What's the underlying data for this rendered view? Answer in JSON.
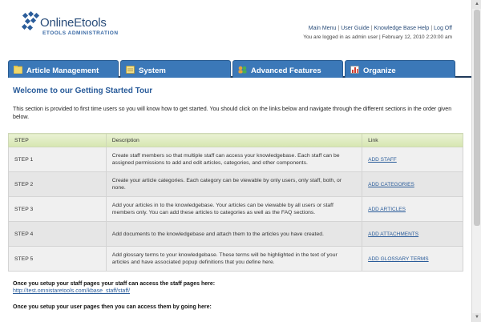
{
  "logo": {
    "name": "OnlineEtools",
    "subtitle": "ETOOLS ADMINISTRATION"
  },
  "header": {
    "links": [
      "Main Menu",
      "User Guide",
      "Knowledge Base Help",
      "Log Off"
    ],
    "login_status": "You are logged in as admin user | February 12, 2010 2:20:00 am"
  },
  "tabs": [
    {
      "label": "Article Management",
      "icon": "folder-icon",
      "color": "#f0d76a"
    },
    {
      "label": "System",
      "icon": "notepad-icon",
      "color": "#f4e08a"
    },
    {
      "label": "Advanced Features",
      "icon": "users-icon",
      "color": "#e8a23a"
    },
    {
      "label": "Organize",
      "icon": "chart-icon",
      "color": "#d23a2a"
    }
  ],
  "main": {
    "title": "Welcome to our Getting Started Tour",
    "intro": "This section is provided to first time users so you will know how to get started. You should click on the links below and navigate through the different sections in the order given below.",
    "table": {
      "headers": [
        "STEP",
        "Description",
        "Link"
      ],
      "rows": [
        {
          "step": "STEP 1",
          "desc": "Create staff members so that multiple staff can access your knowledgebase. Each staff can be assigned permissions to add and edit articles, categories, and other components.",
          "link": "ADD STAFF"
        },
        {
          "step": "STEP 2",
          "desc": "Create your article categories. Each category can be viewable by only users, only staff, both, or none.",
          "link": "ADD CATEGORIES"
        },
        {
          "step": "STEP 3",
          "desc": "Add your articles in to the knowledgebase. Your articles can be viewable by all users or staff members only. You can add these articles to categories as well as the FAQ sections.",
          "link": "ADD ARTICLES"
        },
        {
          "step": "STEP 4",
          "desc": "Add documents to the knowledgebase and attach them to the articles you have created.",
          "link": "ADD ATTACHMENTS"
        },
        {
          "step": "STEP 5",
          "desc": "Add glossary terms to your knowledgebase. These terms will be highlighted in the text of your articles and have associated popup definitions that you define here.",
          "link": "ADD GLOSSARY TERMS"
        }
      ]
    },
    "staff_note": "Once you setup your staff pages your staff can access the staff pages here:",
    "staff_url": "http://test.omnistaretools.com/kbase_staff/staff/",
    "user_note": "Once you setup your user pages then you can access them by going here:"
  }
}
